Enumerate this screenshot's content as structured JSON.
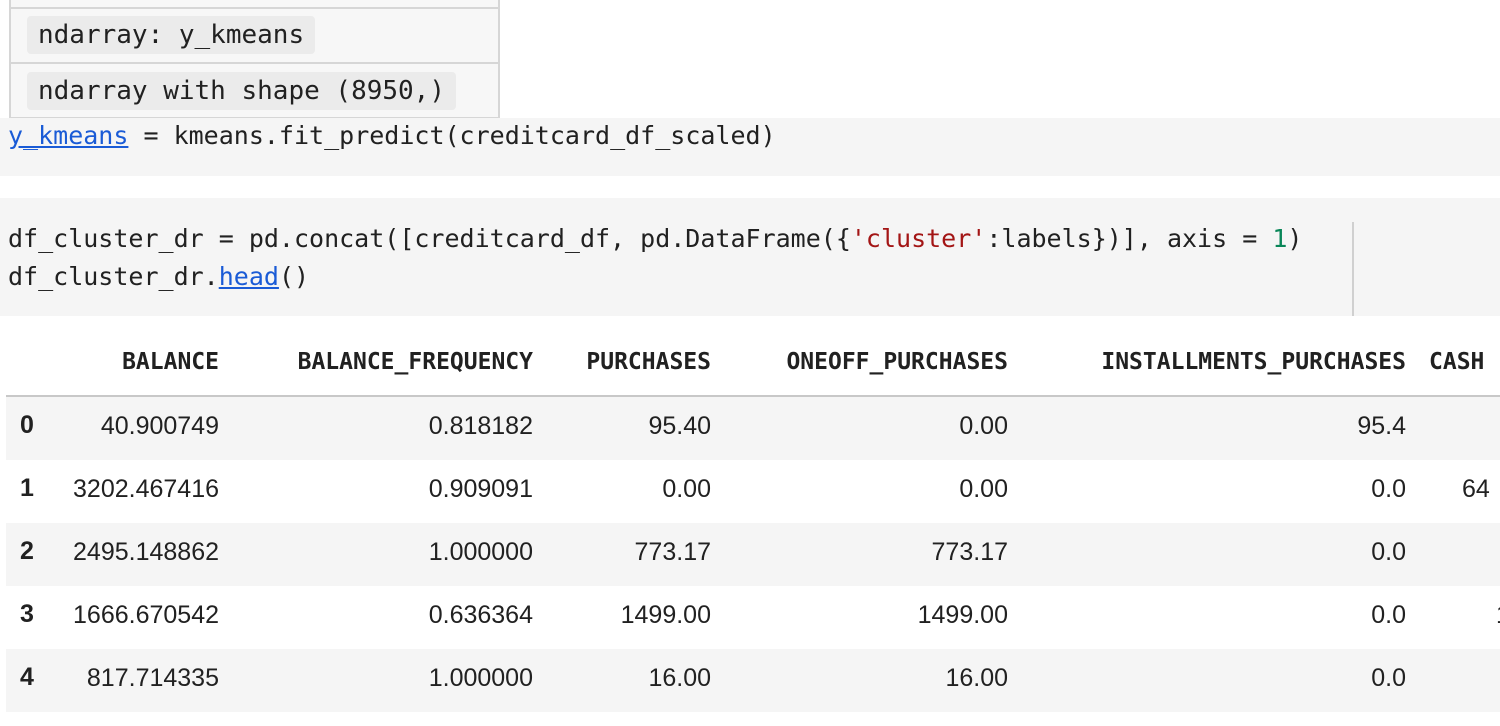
{
  "tooltip": {
    "type_label": "ndarray: y_kmeans",
    "shape_label": "ndarray with shape (8950,)"
  },
  "cell1": {
    "var_link": "y_kmeans",
    "rest": " = kmeans.fit_predict(creditcard_df_scaled)"
  },
  "cell2": {
    "line1_a": "df_cluster_dr = pd.concat([creditcard_df, pd.DataFrame({",
    "line1_str": "'cluster'",
    "line1_b": ":labels})], axis = ",
    "line1_num": "1",
    "line1_c": ")",
    "line2_a": "df_cluster_dr.",
    "line2_link": "head",
    "line2_b": "()"
  },
  "table": {
    "columns": [
      "BALANCE",
      "BALANCE_FREQUENCY",
      "PURCHASES",
      "ONEOFF_PURCHASES",
      "INSTALLMENTS_PURCHASES",
      "CASH"
    ],
    "rows": [
      {
        "index": "0",
        "cells": [
          "40.900749",
          "0.818182",
          "95.40",
          "0.00",
          "95.4",
          ""
        ]
      },
      {
        "index": "1",
        "cells": [
          "3202.467416",
          "0.909091",
          "0.00",
          "0.00",
          "0.0",
          "64"
        ]
      },
      {
        "index": "2",
        "cells": [
          "2495.148862",
          "1.000000",
          "773.17",
          "773.17",
          "0.0",
          ""
        ]
      },
      {
        "index": "3",
        "cells": [
          "1666.670542",
          "0.636364",
          "1499.00",
          "1499.00",
          "0.0",
          "1"
        ]
      },
      {
        "index": "4",
        "cells": [
          "817.714335",
          "1.000000",
          "16.00",
          "16.00",
          "0.0",
          ""
        ]
      }
    ]
  }
}
